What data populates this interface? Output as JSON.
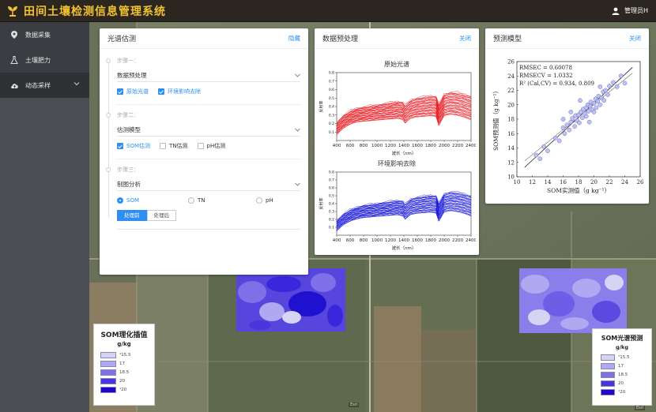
{
  "app": {
    "title": "田间土壤检测信息管理系统",
    "user": "管理员H"
  },
  "sidebar": {
    "items": [
      {
        "label": "数据采集",
        "icon": "location-pin-icon"
      },
      {
        "label": "土壤肥力",
        "icon": "flask-icon"
      },
      {
        "label": "动态采样",
        "icon": "cloud-upload-icon"
      }
    ]
  },
  "estimation_panel": {
    "title": "光谱估测",
    "hide_label": "隐藏",
    "steps": [
      {
        "label": "步骤一：",
        "select": "数据预处理",
        "options": [
          {
            "label": "原始光谱",
            "checked": true
          },
          {
            "label": "环境影响去除",
            "checked": true
          }
        ]
      },
      {
        "label": "步骤二：",
        "select": "估测模型",
        "options": [
          {
            "label": "SOM估测",
            "checked": true
          },
          {
            "label": "TN估测",
            "checked": false
          },
          {
            "label": "pH估测",
            "checked": false
          }
        ]
      },
      {
        "label": "步骤三：",
        "select": "制图分析",
        "radios": [
          {
            "label": "SOM",
            "checked": true
          },
          {
            "label": "TN",
            "checked": false
          },
          {
            "label": "pH",
            "checked": false
          }
        ],
        "buttons": [
          {
            "label": "处理前",
            "active": true
          },
          {
            "label": "处理后",
            "active": false
          }
        ]
      }
    ]
  },
  "preprocess_panel": {
    "title": "数据预处理",
    "close_label": "关闭",
    "chart1_title": "原始光谱",
    "chart2_title": "环境影响去除",
    "ylabel": "反射率",
    "xlabel": "波长（nm）",
    "red": "#e8141b",
    "blue": "#1414d8"
  },
  "model_panel": {
    "title": "预测模型",
    "close_label": "关闭",
    "stat1": "RMSEC = 0.60078",
    "stat2": "RMSECV = 1.0332",
    "stat3": "R² (Cal,CV) = 0.934, 0.809",
    "xlabel": "SOM实测值（g kg⁻¹）",
    "ylabel": "SOM预测值（g kg⁻¹）"
  },
  "legend_left": {
    "title": "SOM理化插值",
    "unit": "g/kg",
    "entries": [
      "¹15.5",
      "17",
      "18.5",
      "20",
      "¹20"
    ],
    "colors": [
      "#d6d3f5",
      "#b0a8f0",
      "#8070e8",
      "#4a35dd",
      "#1e06cf"
    ]
  },
  "legend_right": {
    "title": "SOM光谱预测",
    "unit": "g/kg",
    "entries": [
      "¹15.5",
      "17",
      "18.5",
      "20",
      "¹20"
    ],
    "colors": [
      "#d6d3f5",
      "#b0a8f0",
      "#8070e8",
      "#4a35dd",
      "#1e06cf"
    ]
  },
  "map": {
    "scale_left": "Esri",
    "scale_right": "Esri"
  },
  "chart_data": [
    {
      "type": "line",
      "title": "原始光谱",
      "xlabel": "波长（nm）",
      "ylabel": "反射率",
      "xlim": [
        400,
        2400
      ],
      "ylim": [
        0,
        0.8
      ],
      "xticks": [
        400,
        600,
        800,
        1000,
        1200,
        1400,
        1600,
        1800,
        2000,
        2200,
        2400
      ],
      "yticks": [
        0.1,
        0.2,
        0.3,
        0.4,
        0.5,
        0.6,
        0.7,
        0.8
      ],
      "series_count": 40,
      "x": [
        400,
        500,
        600,
        700,
        800,
        900,
        1000,
        1100,
        1200,
        1300,
        1380,
        1420,
        1500,
        1600,
        1700,
        1800,
        1880,
        1920,
        2000,
        2100,
        2200,
        2300,
        2400
      ],
      "mean_curve": [
        0.14,
        0.22,
        0.27,
        0.3,
        0.31,
        0.32,
        0.33,
        0.34,
        0.35,
        0.36,
        0.35,
        0.31,
        0.37,
        0.39,
        0.4,
        0.41,
        0.4,
        0.3,
        0.42,
        0.44,
        0.43,
        0.41,
        0.38
      ],
      "spread": 0.12,
      "color": "#e8141b"
    },
    {
      "type": "line",
      "title": "环境影响去除",
      "xlabel": "波长（nm）",
      "ylabel": "反射率",
      "xlim": [
        400,
        2400
      ],
      "ylim": [
        0,
        0.8
      ],
      "xticks": [
        400,
        600,
        800,
        1000,
        1200,
        1400,
        1600,
        1800,
        2000,
        2200,
        2400
      ],
      "yticks": [
        0.1,
        0.2,
        0.3,
        0.4,
        0.5,
        0.6,
        0.7,
        0.8
      ],
      "series_count": 40,
      "x": [
        400,
        500,
        600,
        700,
        800,
        900,
        1000,
        1100,
        1200,
        1300,
        1380,
        1420,
        1500,
        1600,
        1700,
        1800,
        1880,
        1920,
        2000,
        2100,
        2200,
        2300,
        2400
      ],
      "mean_curve": [
        0.12,
        0.2,
        0.25,
        0.28,
        0.3,
        0.31,
        0.32,
        0.33,
        0.34,
        0.35,
        0.34,
        0.3,
        0.36,
        0.38,
        0.39,
        0.4,
        0.39,
        0.29,
        0.41,
        0.43,
        0.42,
        0.4,
        0.37
      ],
      "spread": 0.11,
      "color": "#1414d8"
    },
    {
      "type": "scatter",
      "xlabel": "SOM实测值（g kg⁻¹）",
      "ylabel": "SOM预测值（g kg⁻¹）",
      "xlim": [
        10,
        26
      ],
      "ylim": [
        10,
        26
      ],
      "xticks": [
        10,
        12,
        14,
        16,
        18,
        20,
        22,
        24,
        26
      ],
      "yticks": [
        10,
        12,
        14,
        16,
        18,
        20,
        22,
        24,
        26
      ],
      "points": [
        [
          12.5,
          13.0
        ],
        [
          13.0,
          12.5
        ],
        [
          13.5,
          14.2
        ],
        [
          14.0,
          13.6
        ],
        [
          15.0,
          15.4
        ],
        [
          15.5,
          15.0
        ],
        [
          16.0,
          16.8
        ],
        [
          16.2,
          16.0
        ],
        [
          16.5,
          17.2
        ],
        [
          16.8,
          16.5
        ],
        [
          17.0,
          17.6
        ],
        [
          17.2,
          18.1
        ],
        [
          17.5,
          17.0
        ],
        [
          17.6,
          18.5
        ],
        [
          17.8,
          17.8
        ],
        [
          18.0,
          18.6
        ],
        [
          18.1,
          17.5
        ],
        [
          18.3,
          19.0
        ],
        [
          18.5,
          18.2
        ],
        [
          18.6,
          19.4
        ],
        [
          18.8,
          18.8
        ],
        [
          19.0,
          19.6
        ],
        [
          19.0,
          18.4
        ],
        [
          19.2,
          20.0
        ],
        [
          19.3,
          19.1
        ],
        [
          19.5,
          19.8
        ],
        [
          19.6,
          20.4
        ],
        [
          19.8,
          19.3
        ],
        [
          20.0,
          20.2
        ],
        [
          20.0,
          19.0
        ],
        [
          20.2,
          20.8
        ],
        [
          20.3,
          19.6
        ],
        [
          20.5,
          20.5
        ],
        [
          20.6,
          21.2
        ],
        [
          20.8,
          20.0
        ],
        [
          21.0,
          21.0
        ],
        [
          21.2,
          21.8
        ],
        [
          21.3,
          20.6
        ],
        [
          21.5,
          22.0
        ],
        [
          21.8,
          21.4
        ],
        [
          22.0,
          22.6
        ],
        [
          22.5,
          23.1
        ],
        [
          23.0,
          22.5
        ],
        [
          23.5,
          24.0
        ],
        [
          24.0,
          23.0
        ],
        [
          19.4,
          17.6
        ],
        [
          18.2,
          20.6
        ],
        [
          17.0,
          19.0
        ],
        [
          20.8,
          22.5
        ],
        [
          16.0,
          18.0
        ]
      ],
      "fit_lines": 2,
      "marker_color": "#b9bdf0"
    }
  ]
}
